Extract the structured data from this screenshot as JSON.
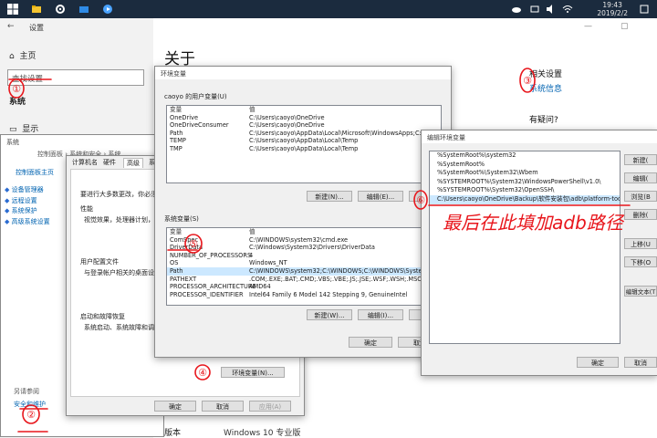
{
  "taskbar": {
    "time": "19:43",
    "date": "2019/2/2"
  },
  "settings": {
    "title": "设置",
    "nav_home": "主页",
    "search_placeholder": "查找设置",
    "category": "系统",
    "display": "显示",
    "about": "关于",
    "main_title": "关于",
    "related_title": "相关设置",
    "related_link": "系统信息",
    "question": "有疑问?",
    "edition_label": "版本",
    "edition_value": "Windows 10 专业版"
  },
  "system_window": {
    "title": "系统",
    "breadcrumb": "控制面板 › 系统和安全 › 系统",
    "cp_home": "控制面板主页",
    "links": [
      "设备管理器",
      "远程设置",
      "系统保护",
      "高级系统设置"
    ],
    "see_also": "另请参阅",
    "security": "安全和维护"
  },
  "sysprops": {
    "title": "系统属性",
    "tabs": [
      "计算机名",
      "硬件",
      "高级",
      "系统保护"
    ],
    "admin_note": "要进行大多数更改，你必须作为管理员登录。",
    "perf_title": "性能",
    "perf_desc": "视觉效果，处理器计划，内存使用，以及虚拟内存",
    "profile_title": "用户配置文件",
    "profile_desc": "与登录帐户相关的桌面设置",
    "startup_title": "启动和故障恢复",
    "startup_desc": "系统启动、系统故障和调试信息",
    "env_button": "环境变量(N)...",
    "ok": "确定",
    "cancel": "取消",
    "apply": "应用(A)"
  },
  "envvars": {
    "title": "环境变量",
    "user_group": "caoyo 的用户变量(U)",
    "sys_group": "系统变量(S)",
    "col_var": "变量",
    "col_val": "值",
    "user_vars": [
      {
        "name": "OneDrive",
        "value": "C:\\Users\\caoyo\\OneDrive"
      },
      {
        "name": "OneDriveConsumer",
        "value": "C:\\Users\\caoyo\\OneDrive"
      },
      {
        "name": "Path",
        "value": "C:\\Users\\caoyo\\AppData\\Local\\Microsoft\\WindowsApps;C:\\Us"
      },
      {
        "name": "TEMP",
        "value": "C:\\Users\\caoyo\\AppData\\Local\\Temp"
      },
      {
        "name": "TMP",
        "value": "C:\\Users\\caoyo\\AppData\\Local\\Temp"
      }
    ],
    "sys_vars": [
      {
        "name": "ComSpec",
        "value": "C:\\WINDOWS\\system32\\cmd.exe"
      },
      {
        "name": "DriverData",
        "value": "C:\\Windows\\System32\\Drivers\\DriverData"
      },
      {
        "name": "NUMBER_OF_PROCESSORS",
        "value": "4"
      },
      {
        "name": "OS",
        "value": "Windows_NT"
      },
      {
        "name": "Path",
        "value": "C:\\WINDOWS\\system32;C:\\WINDOWS;C:\\WINDOWS\\System32"
      },
      {
        "name": "PATHEXT",
        "value": ".COM;.EXE;.BAT;.CMD;.VBS;.VBE;.JS;.JSE;.WSF;.WSH;.MSC"
      },
      {
        "name": "PROCESSOR_ARCHITECTURE",
        "value": "AMD64"
      },
      {
        "name": "PROCESSOR_IDENTIFIER",
        "value": "Intel64 Family 6 Model 142 Stepping 9, GenuineIntel"
      }
    ],
    "new": "新建(N)...",
    "new2": "新建(W)...",
    "edit": "编辑(E)...",
    "edit2": "编辑(I)...",
    "delete": "删除",
    "ok": "确定",
    "cancel": "取消"
  },
  "editenv": {
    "title": "编辑环境变量",
    "entries": [
      "%SystemRoot%\\system32",
      "%SystemRoot%",
      "%SystemRoot%\\System32\\Wbem",
      "%SYSTEMROOT%\\System32\\WindowsPowerShell\\v1.0\\",
      "%SYSTEMROOT%\\System32\\OpenSSH\\",
      "C:\\Users\\caoyo\\OneDrive\\Backup\\软件安装包\\adb\\platform-tools"
    ],
    "buttons": [
      "新建(",
      "编辑(",
      "浏览(B",
      "删除(",
      "上移(U",
      "下移(O",
      "编辑文本(T"
    ],
    "ok": "确定",
    "cancel": "取消"
  },
  "annotations": {
    "note": "最后在此填加adb路径",
    "n1": "①",
    "n2": "②",
    "n3": "③",
    "n4": "④",
    "n5": "⑤",
    "n6": "⑥",
    "color": "#e8161c"
  }
}
